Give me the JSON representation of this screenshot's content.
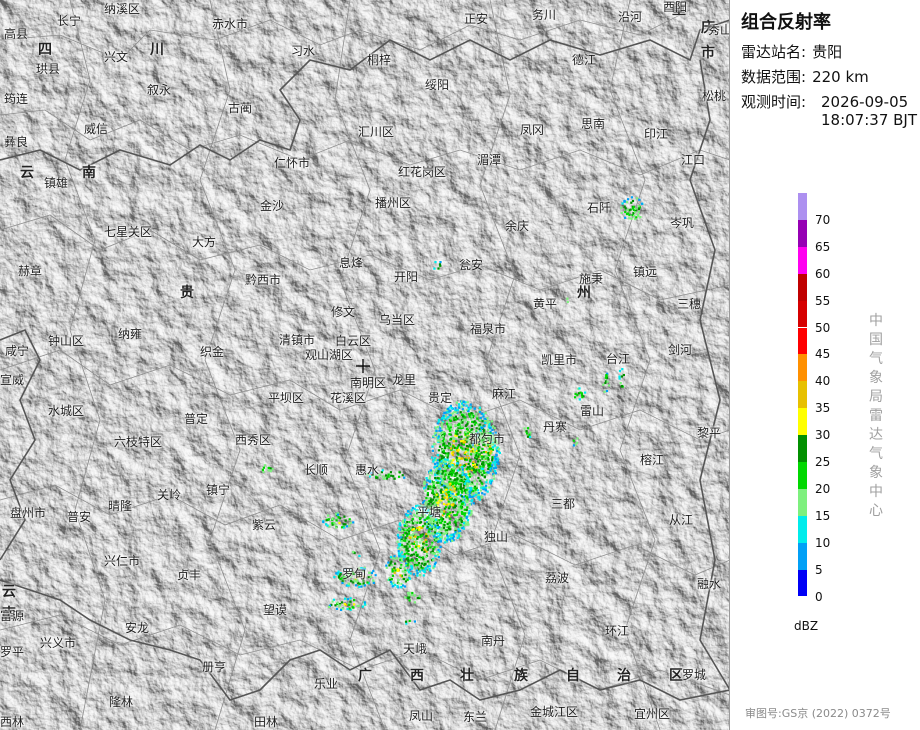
{
  "product_title": "组合反射率",
  "info": {
    "station_label": "雷达站名:",
    "station": "贵阳",
    "range_label": "数据范围:",
    "range": "220 km",
    "time_label": "观测时间:",
    "time_date": "2026-09-05",
    "time_clock": "18:07:37 BJT"
  },
  "legend": {
    "levels": [
      "0",
      "5",
      "10",
      "15",
      "20",
      "25",
      "30",
      "35",
      "40",
      "45",
      "50",
      "55",
      "60",
      "65",
      "70"
    ],
    "colors": [
      "#0000f6",
      "#01a0f6",
      "#00ecec",
      "#7ef07e",
      "#00d800",
      "#019000",
      "#ffff00",
      "#e7c000",
      "#ff9000",
      "#ff0000",
      "#d60000",
      "#c00000",
      "#ff00f0",
      "#9600b4",
      "#ad90f0"
    ],
    "unit": "dBZ"
  },
  "organization": "中国气象局雷达气象中心",
  "approval_number": "审图号:GS京 (2022) 0372号",
  "map": {
    "regions": [
      "四",
      "川",
      "云",
      "南",
      "贵",
      "州",
      "广",
      "西",
      "壮",
      "族",
      "自",
      "治",
      "区",
      "重",
      "庆",
      "市",
      "云",
      "南"
    ],
    "places": [
      "高县",
      "长宁",
      "纳溪区",
      "赤水市",
      "正安",
      "务川",
      "沿河",
      "酉阳",
      "秀山",
      "珙县",
      "兴文",
      "习水",
      "桐梓",
      "绥阳",
      "德江",
      "筠连",
      "叙永",
      "古蔺",
      "凤冈",
      "思南",
      "松桃",
      "彝良",
      "威信",
      "汇川区",
      "湄潭",
      "印江",
      "镇雄",
      "仁怀市",
      "红花岗区",
      "江口",
      "金沙",
      "播州区",
      "余庆",
      "石阡",
      "七星关区",
      "大方",
      "岑巩",
      "赫章",
      "黔西市",
      "息烽",
      "开阳",
      "瓮安",
      "施秉",
      "镇远",
      "修文",
      "黄平",
      "三穗",
      "乌当区",
      "钟山区",
      "纳雍",
      "清镇市",
      "白云区",
      "福泉市",
      "剑河",
      "咸宁",
      "织金",
      "观山湖区",
      "凯里市",
      "台江",
      "宣威",
      "南明区",
      "龙里",
      "平坝区",
      "花溪区",
      "贵定",
      "麻江",
      "水城区",
      "雷山",
      "普定",
      "丹寨",
      "六枝特区",
      "西秀区",
      "都匀市",
      "黎平",
      "长顺",
      "惠水",
      "榕江",
      "盘州市",
      "晴隆",
      "关岭",
      "镇宁",
      "平塘",
      "三都",
      "普安",
      "紫云",
      "从江",
      "兴仁市",
      "贞丰",
      "独山",
      "荔波",
      "望谟",
      "罗甸",
      "融水",
      "富源",
      "安龙",
      "环江",
      "兴义市",
      "罗平",
      "册亨",
      "天峨",
      "南丹",
      "乐业",
      "罗城",
      "隆林",
      "西林",
      "田林",
      "凤山",
      "东兰",
      "金城江区",
      "宜州区"
    ]
  }
}
